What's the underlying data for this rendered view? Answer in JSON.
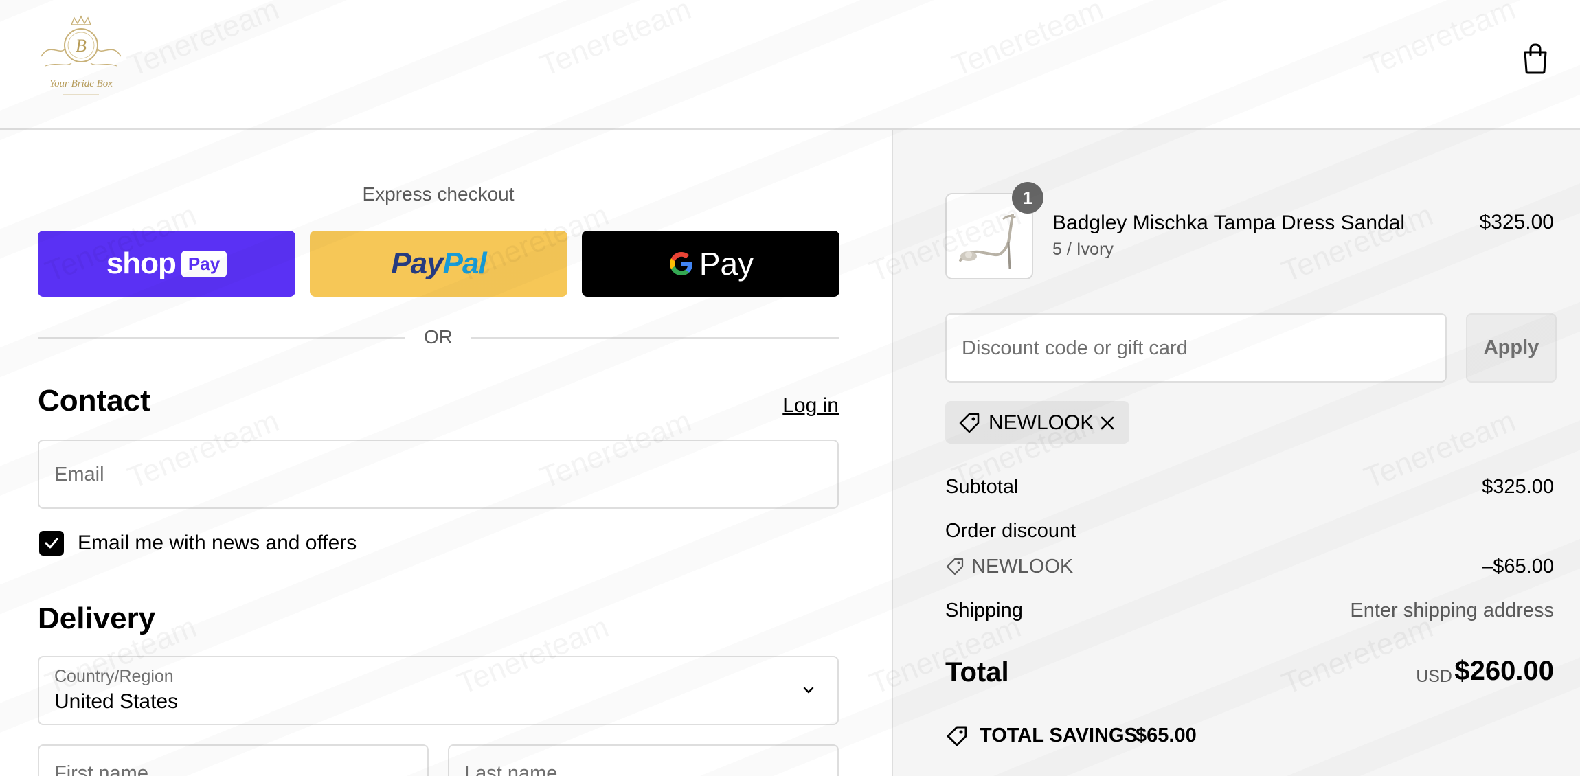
{
  "brand": {
    "logo_initial": "B",
    "logo_text": "Your Bride Box"
  },
  "express": {
    "title": "Express checkout",
    "shop_pay": {
      "word": "shop",
      "chip": "Pay"
    },
    "paypal": {
      "part1": "Pay",
      "part2": "Pal"
    },
    "gpay": {
      "word": "Pay"
    },
    "or": "OR"
  },
  "contact": {
    "title": "Contact",
    "login": "Log in",
    "email_placeholder": "Email",
    "newsletter_label": "Email me with news and offers",
    "newsletter_checked": true
  },
  "delivery": {
    "title": "Delivery",
    "country_label": "Country/Region",
    "country_value": "United States",
    "first_name_placeholder": "First name",
    "last_name_placeholder": "Last name"
  },
  "cart": {
    "item": {
      "quantity": "1",
      "name": "Badgley Mischka Tampa Dress Sandal",
      "variant": "5 / Ivory",
      "price": "$325.00"
    },
    "discount_placeholder": "Discount code or gift card",
    "apply_label": "Apply",
    "applied_code": "NEWLOOK"
  },
  "summary": {
    "subtotal_label": "Subtotal",
    "subtotal_value": "$325.00",
    "order_discount_label": "Order discount",
    "discount_code": "NEWLOOK",
    "discount_value": "–$65.00",
    "shipping_label": "Shipping",
    "shipping_value": "Enter shipping address",
    "total_label": "Total",
    "currency": "USD",
    "total_value": "$260.00",
    "savings_label": "TOTAL SAVINGS",
    "savings_value": "$65.00"
  },
  "watermark": "Tenereteam",
  "colors": {
    "shop_pay": "#5a31f4",
    "paypal": "#f6c757",
    "gpay": "#000000",
    "summary_bg": "#f5f5f5"
  }
}
